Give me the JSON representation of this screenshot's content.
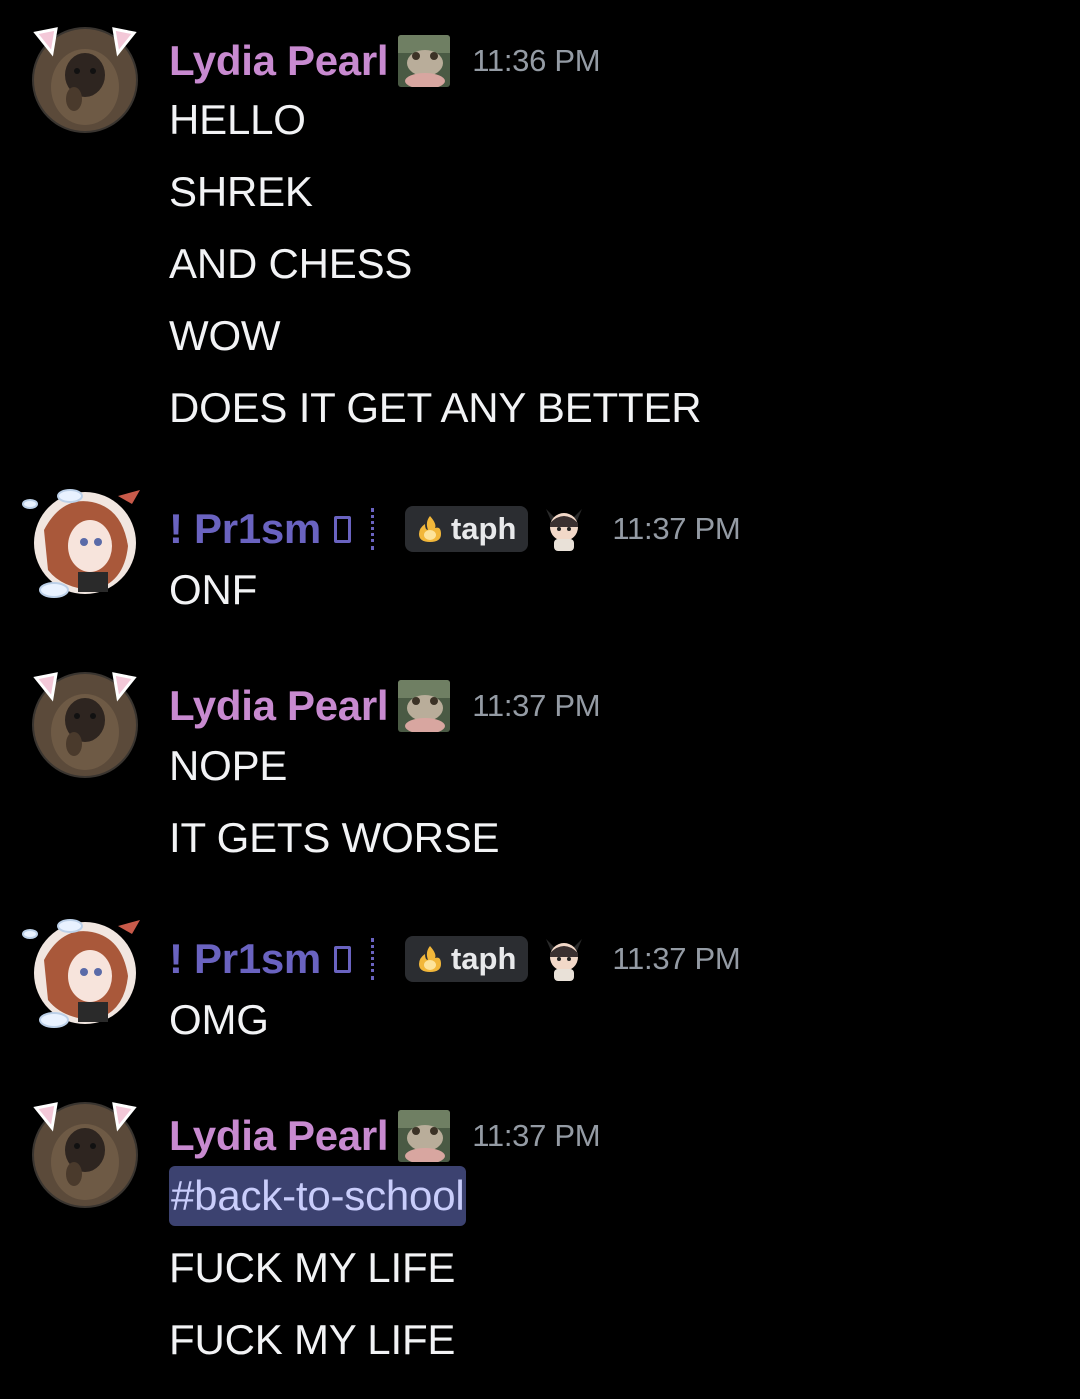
{
  "colors": {
    "background": "#000000",
    "lydia_name": "#c88ad0",
    "prism_name": "#6a63c0",
    "timestamp": "#949ba4",
    "message_text": "#f2f3f5",
    "mention_bg": "#3c4270",
    "mention_text": "#c9cdfb",
    "tag_bg": "#2b2d31"
  },
  "messages": [
    {
      "author": "Lydia Pearl",
      "avatar_icon": "monkey-avatar-icon",
      "name_deco_icon": "frog-photo-icon",
      "timestamp": "11:36 PM",
      "lines": [
        "HELLO",
        "SHREK",
        "AND CHESS",
        "WOW",
        "DOES IT GET ANY BETTER"
      ]
    },
    {
      "author": "! Pr1sm",
      "avatar_icon": "anime-girl-avatar-icon",
      "tag_icon": "fire-icon",
      "tag": "taph",
      "badge_icon": "chibi-character-icon",
      "timestamp": "11:37 PM",
      "lines": [
        "ONF"
      ]
    },
    {
      "author": "Lydia Pearl",
      "avatar_icon": "monkey-avatar-icon",
      "name_deco_icon": "frog-photo-icon",
      "timestamp": "11:37 PM",
      "lines": [
        "NOPE",
        "IT GETS WORSE"
      ]
    },
    {
      "author": "! Pr1sm",
      "avatar_icon": "anime-girl-avatar-icon",
      "tag_icon": "fire-icon",
      "tag": "taph",
      "badge_icon": "chibi-character-icon",
      "timestamp": "11:37 PM",
      "lines": [
        "OMG"
      ]
    },
    {
      "author": "Lydia Pearl",
      "avatar_icon": "monkey-avatar-icon",
      "name_deco_icon": "frog-photo-icon",
      "timestamp": "11:37 PM",
      "channel_mention": "#back-to-school",
      "lines": [
        "FUCK MY LIFE",
        "FUCK MY LIFE"
      ]
    }
  ]
}
